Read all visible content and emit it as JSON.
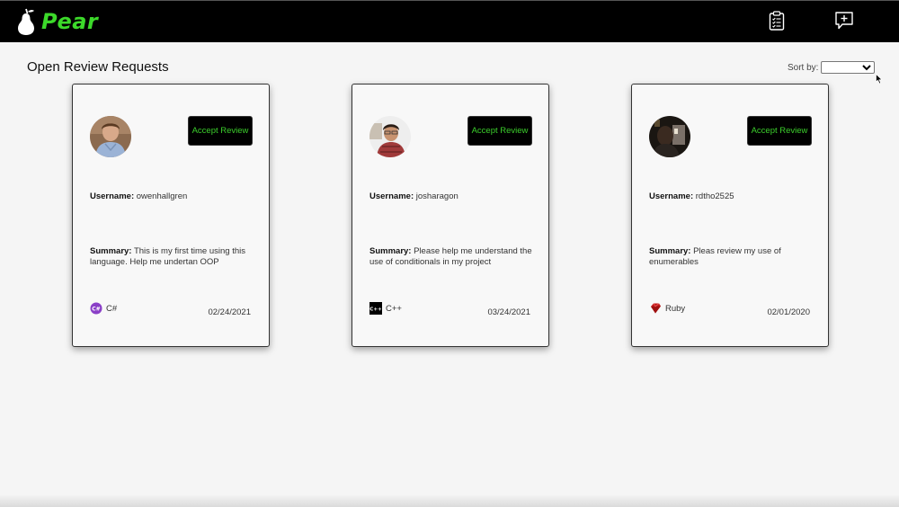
{
  "app": {
    "name": "Pear",
    "accent_color": "#3cd92a"
  },
  "nav": {
    "icons": [
      "clipboard-list-icon",
      "chat-plus-icon"
    ]
  },
  "page": {
    "title": "Open Review Requests",
    "sort_label": "Sort by:",
    "sort_value": ""
  },
  "labels": {
    "username": "Username:",
    "summary": "Summary:",
    "accept": "Accept Review"
  },
  "cards": [
    {
      "username": "owenhallgren",
      "summary": "This is my first time using this language. Help me undertan OOP",
      "language": "C#",
      "language_icon": "csharp-icon",
      "date": "02/24/2021"
    },
    {
      "username": "josharagon",
      "summary": "Please help me understand the use of conditionals in my project",
      "language": "C++",
      "language_icon": "cplusplus-icon",
      "date": "03/24/2021"
    },
    {
      "username": "rdtho2525",
      "summary": "Pleas review my use of enumerables",
      "language": "Ruby",
      "language_icon": "ruby-icon",
      "date": "02/01/2020"
    }
  ]
}
